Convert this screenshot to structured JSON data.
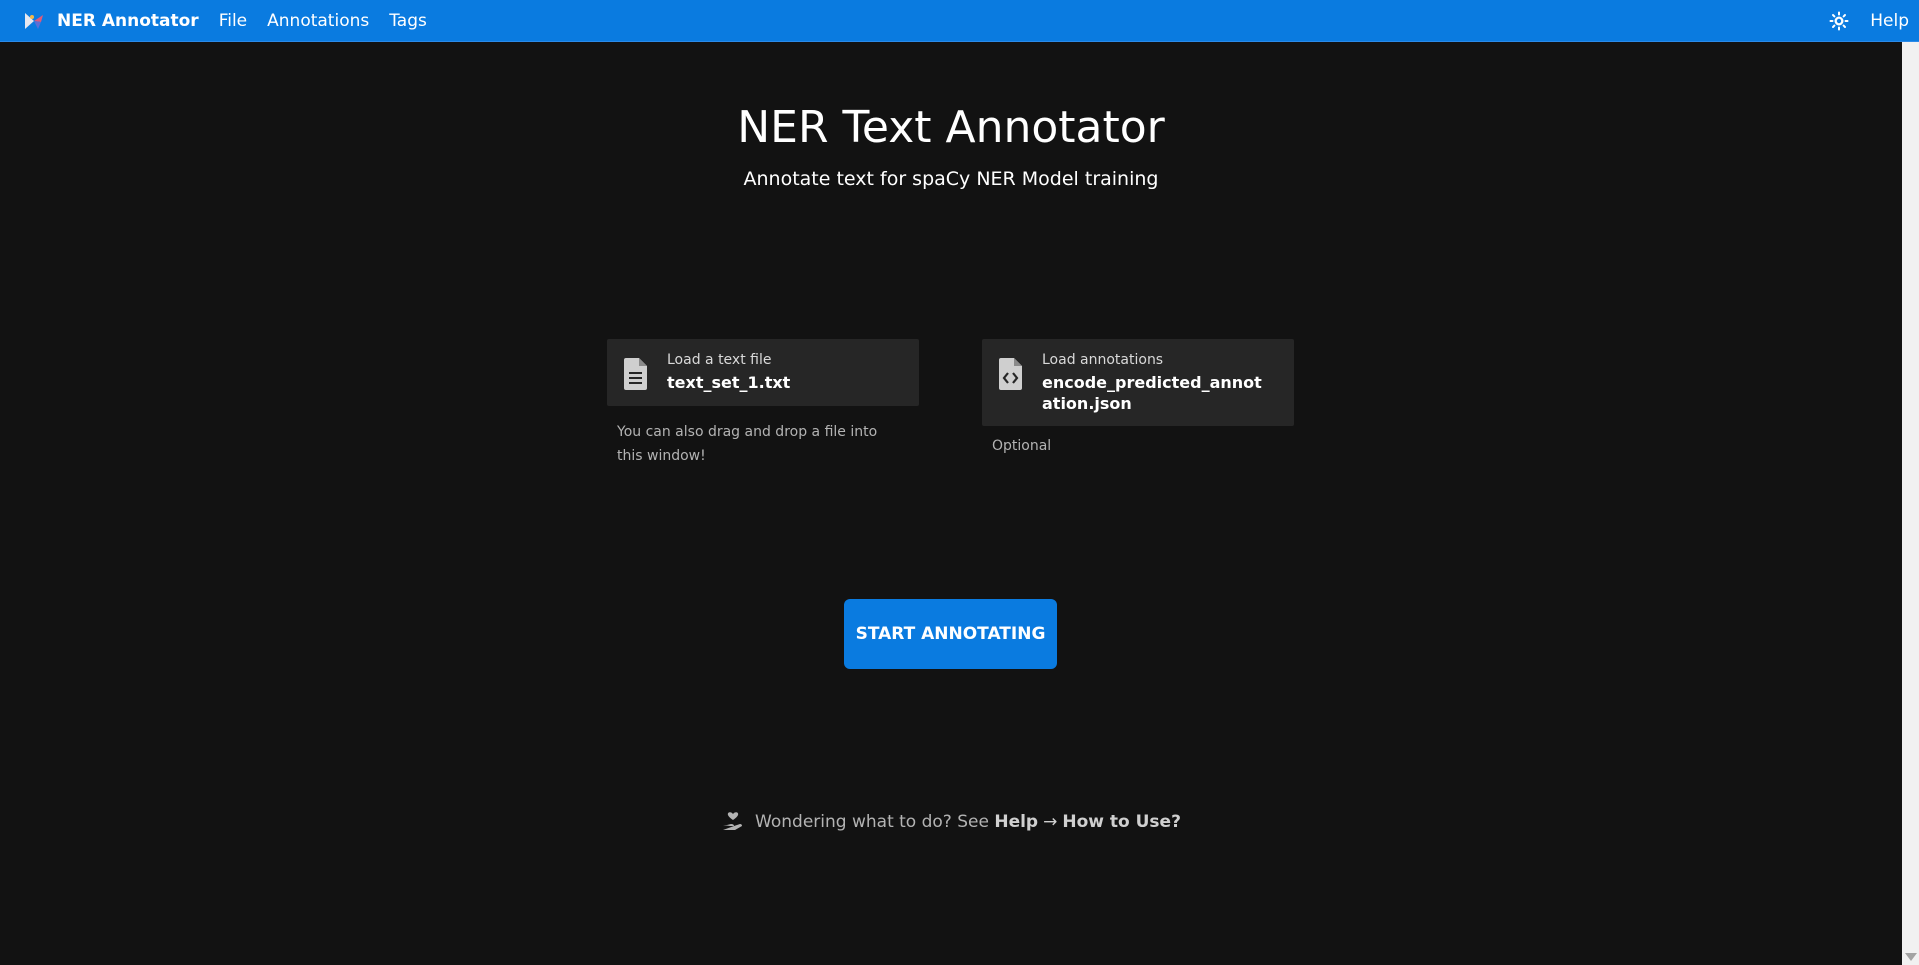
{
  "topbar": {
    "brand": "NER Annotator",
    "menu": [
      "File",
      "Annotations",
      "Tags"
    ],
    "help": "Help",
    "theme_icon": "sun-icon",
    "logo_icon": "ner-logo-icon"
  },
  "main": {
    "title": "NER Text Annotator",
    "subtitle": "Annotate text for spaCy NER Model training",
    "text_file": {
      "label": "Load a text file",
      "value": "text_set_1.txt",
      "hint": "You can also drag and drop a file into this window!",
      "icon": "document-icon"
    },
    "annotations_file": {
      "label": "Load annotations",
      "value": "encode_predicted_annotation.json",
      "hint": "Optional",
      "icon": "code-file-icon"
    },
    "start_button": "START ANNOTATING",
    "footer": {
      "prefix": "Wondering what to do? See",
      "help": "Help",
      "how_to": "How to Use?",
      "icon": "hand-heart-icon"
    }
  },
  "colors": {
    "accent": "#0a7be0",
    "background": "#121212",
    "card": "#262626"
  }
}
